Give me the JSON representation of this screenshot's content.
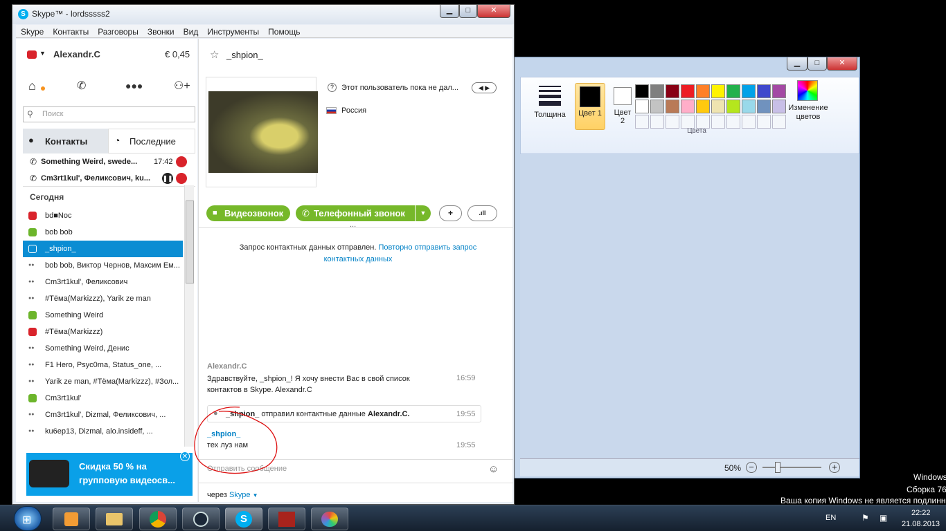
{
  "skype": {
    "title": "Skype™ - lordsssss2",
    "menu": [
      "Skype",
      "Контакты",
      "Разговоры",
      "Звонки",
      "Вид",
      "Инструменты",
      "Помощь"
    ],
    "user_name": "Alexandr.C",
    "balance": "€ 0,45",
    "search_placeholder": "Поиск",
    "tab_contacts": "Контакты",
    "tab_recent": "Последние",
    "active_calls": [
      {
        "name": "Something Weird, swede...",
        "time": "17:42"
      },
      {
        "name": "Cm3rt1kul', Феликсович, ku...",
        "time": ""
      }
    ],
    "section_today": "Сегодня",
    "recent": [
      {
        "name": "bd■Noc",
        "status": "red"
      },
      {
        "name": "bob bob",
        "status": "green"
      },
      {
        "name": "_shpion_",
        "status": "unknown",
        "selected": true
      },
      {
        "name": "bob bob, Виктор Чернов, Максим Ем...",
        "status": "group"
      },
      {
        "name": "Cm3rt1kul', Феликсович",
        "status": "group"
      },
      {
        "name": "#Тёма(Markizzz), Yarik ze man",
        "status": "group"
      },
      {
        "name": "Something Weird",
        "status": "green"
      },
      {
        "name": "#Тёма(Markizzz)",
        "status": "red"
      },
      {
        "name": "Something Weird, Денис",
        "status": "group"
      },
      {
        "name": "F1 Hero, Psyc0ma, Status_one, ...",
        "status": "group"
      },
      {
        "name": "Yarik ze man, #Тёма(Markizzz), #Зол...",
        "status": "group"
      },
      {
        "name": "Cm3rt1kul'",
        "status": "green"
      },
      {
        "name": "Cm3rt1kul', Dizmal, Феликсович, ...",
        "status": "group"
      },
      {
        "name": "ku6ep13, Dizmal, alo.insideff, ...",
        "status": "group"
      }
    ],
    "ad_text": "Скидка 50 % на групповую видеосв...",
    "contact_name": "_shpion_",
    "mood_text": "Этот пользователь пока не дал...",
    "country": "Россия",
    "video_call": "Видеозвонок",
    "phone_call": "Телефонный звонок",
    "dots": "...",
    "request_text": "Запрос контактных данных отправлен.",
    "resend_link": "Повторно отправить запрос контактных данных",
    "messages": [
      {
        "author": "Alexandr.C",
        "text": "Здравствуйте, _shpion_! Я хочу внести Вас в свой список контактов в Skype. Alexandr.C",
        "time": "16:59"
      },
      {
        "author": "_shpion_",
        "action": "отправил контактные данные",
        "target": "Alexandr.C.",
        "time": "19:55"
      },
      {
        "author": "_shpion_",
        "text": "тех луз нам",
        "time": "19:55"
      }
    ],
    "input_placeholder": "Отправить сообщение",
    "via_label": "через",
    "via_link": "Skype"
  },
  "paint": {
    "thickness": "Толщина",
    "color1": "Цвет 1",
    "color2": "Цвет 2",
    "colors_group": "Цвета",
    "edit_colors": "Изменение цветов",
    "zoom": "50%",
    "palette_row1": [
      "#000000",
      "#7f7f7f",
      "#880015",
      "#ed1c24",
      "#ff7f27",
      "#fff200",
      "#22b14c",
      "#00a2e8",
      "#3f48cc",
      "#a349a4"
    ],
    "palette_row2": [
      "#ffffff",
      "#c3c3c3",
      "#b97a57",
      "#ffaec9",
      "#ffc90e",
      "#efe4b0",
      "#b5e61d",
      "#99d9ea",
      "#7092be",
      "#c8bfe7"
    ]
  },
  "desktop": {
    "watermark1": "Windows",
    "watermark2": "Сборка 76",
    "watermark3": "Ваша копия Windows не является подлинно"
  },
  "taskbar": {
    "lang": "EN",
    "time": "22:22",
    "date": "21.08.2013"
  }
}
